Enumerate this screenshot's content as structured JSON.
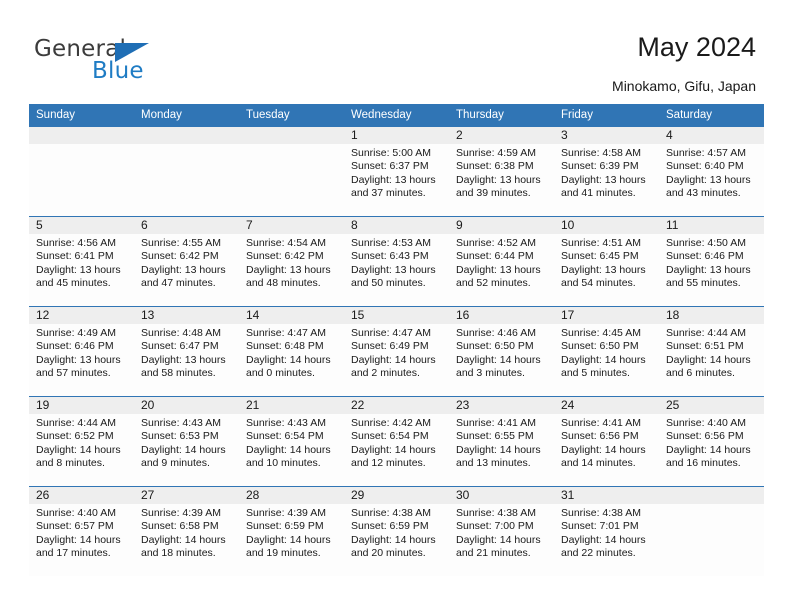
{
  "brand": {
    "name_top": "General",
    "name_bottom": "Blue",
    "accent_color": "#1f7cc4",
    "triangle_color": "#1f6eb5"
  },
  "header": {
    "title": "May 2024",
    "subtitle": "Minokamo, Gifu, Japan"
  },
  "calendar": {
    "header_bg": "#3075b5",
    "daynum_bg": "#eeeeee",
    "weekdays": [
      "Sunday",
      "Monday",
      "Tuesday",
      "Wednesday",
      "Thursday",
      "Friday",
      "Saturday"
    ],
    "weeks": [
      {
        "daynums": [
          "",
          "",
          "",
          "1",
          "2",
          "3",
          "4"
        ],
        "cells": [
          {
            "empty": true,
            "l1": "",
            "l2": "",
            "l3": "",
            "l4": ""
          },
          {
            "empty": true,
            "l1": "",
            "l2": "",
            "l3": "",
            "l4": ""
          },
          {
            "empty": true,
            "l1": "",
            "l2": "",
            "l3": "",
            "l4": ""
          },
          {
            "empty": false,
            "l1": "Sunrise: 5:00 AM",
            "l2": "Sunset: 6:37 PM",
            "l3": "Daylight: 13 hours",
            "l4": "and 37 minutes."
          },
          {
            "empty": false,
            "l1": "Sunrise: 4:59 AM",
            "l2": "Sunset: 6:38 PM",
            "l3": "Daylight: 13 hours",
            "l4": "and 39 minutes."
          },
          {
            "empty": false,
            "l1": "Sunrise: 4:58 AM",
            "l2": "Sunset: 6:39 PM",
            "l3": "Daylight: 13 hours",
            "l4": "and 41 minutes."
          },
          {
            "empty": false,
            "l1": "Sunrise: 4:57 AM",
            "l2": "Sunset: 6:40 PM",
            "l3": "Daylight: 13 hours",
            "l4": "and 43 minutes."
          }
        ]
      },
      {
        "daynums": [
          "5",
          "6",
          "7",
          "8",
          "9",
          "10",
          "11"
        ],
        "cells": [
          {
            "empty": false,
            "l1": "Sunrise: 4:56 AM",
            "l2": "Sunset: 6:41 PM",
            "l3": "Daylight: 13 hours",
            "l4": "and 45 minutes."
          },
          {
            "empty": false,
            "l1": "Sunrise: 4:55 AM",
            "l2": "Sunset: 6:42 PM",
            "l3": "Daylight: 13 hours",
            "l4": "and 47 minutes."
          },
          {
            "empty": false,
            "l1": "Sunrise: 4:54 AM",
            "l2": "Sunset: 6:42 PM",
            "l3": "Daylight: 13 hours",
            "l4": "and 48 minutes."
          },
          {
            "empty": false,
            "l1": "Sunrise: 4:53 AM",
            "l2": "Sunset: 6:43 PM",
            "l3": "Daylight: 13 hours",
            "l4": "and 50 minutes."
          },
          {
            "empty": false,
            "l1": "Sunrise: 4:52 AM",
            "l2": "Sunset: 6:44 PM",
            "l3": "Daylight: 13 hours",
            "l4": "and 52 minutes."
          },
          {
            "empty": false,
            "l1": "Sunrise: 4:51 AM",
            "l2": "Sunset: 6:45 PM",
            "l3": "Daylight: 13 hours",
            "l4": "and 54 minutes."
          },
          {
            "empty": false,
            "l1": "Sunrise: 4:50 AM",
            "l2": "Sunset: 6:46 PM",
            "l3": "Daylight: 13 hours",
            "l4": "and 55 minutes."
          }
        ]
      },
      {
        "daynums": [
          "12",
          "13",
          "14",
          "15",
          "16",
          "17",
          "18"
        ],
        "cells": [
          {
            "empty": false,
            "l1": "Sunrise: 4:49 AM",
            "l2": "Sunset: 6:46 PM",
            "l3": "Daylight: 13 hours",
            "l4": "and 57 minutes."
          },
          {
            "empty": false,
            "l1": "Sunrise: 4:48 AM",
            "l2": "Sunset: 6:47 PM",
            "l3": "Daylight: 13 hours",
            "l4": "and 58 minutes."
          },
          {
            "empty": false,
            "l1": "Sunrise: 4:47 AM",
            "l2": "Sunset: 6:48 PM",
            "l3": "Daylight: 14 hours",
            "l4": "and 0 minutes."
          },
          {
            "empty": false,
            "l1": "Sunrise: 4:47 AM",
            "l2": "Sunset: 6:49 PM",
            "l3": "Daylight: 14 hours",
            "l4": "and 2 minutes."
          },
          {
            "empty": false,
            "l1": "Sunrise: 4:46 AM",
            "l2": "Sunset: 6:50 PM",
            "l3": "Daylight: 14 hours",
            "l4": "and 3 minutes."
          },
          {
            "empty": false,
            "l1": "Sunrise: 4:45 AM",
            "l2": "Sunset: 6:50 PM",
            "l3": "Daylight: 14 hours",
            "l4": "and 5 minutes."
          },
          {
            "empty": false,
            "l1": "Sunrise: 4:44 AM",
            "l2": "Sunset: 6:51 PM",
            "l3": "Daylight: 14 hours",
            "l4": "and 6 minutes."
          }
        ]
      },
      {
        "daynums": [
          "19",
          "20",
          "21",
          "22",
          "23",
          "24",
          "25"
        ],
        "cells": [
          {
            "empty": false,
            "l1": "Sunrise: 4:44 AM",
            "l2": "Sunset: 6:52 PM",
            "l3": "Daylight: 14 hours",
            "l4": "and 8 minutes."
          },
          {
            "empty": false,
            "l1": "Sunrise: 4:43 AM",
            "l2": "Sunset: 6:53 PM",
            "l3": "Daylight: 14 hours",
            "l4": "and 9 minutes."
          },
          {
            "empty": false,
            "l1": "Sunrise: 4:43 AM",
            "l2": "Sunset: 6:54 PM",
            "l3": "Daylight: 14 hours",
            "l4": "and 10 minutes."
          },
          {
            "empty": false,
            "l1": "Sunrise: 4:42 AM",
            "l2": "Sunset: 6:54 PM",
            "l3": "Daylight: 14 hours",
            "l4": "and 12 minutes."
          },
          {
            "empty": false,
            "l1": "Sunrise: 4:41 AM",
            "l2": "Sunset: 6:55 PM",
            "l3": "Daylight: 14 hours",
            "l4": "and 13 minutes."
          },
          {
            "empty": false,
            "l1": "Sunrise: 4:41 AM",
            "l2": "Sunset: 6:56 PM",
            "l3": "Daylight: 14 hours",
            "l4": "and 14 minutes."
          },
          {
            "empty": false,
            "l1": "Sunrise: 4:40 AM",
            "l2": "Sunset: 6:56 PM",
            "l3": "Daylight: 14 hours",
            "l4": "and 16 minutes."
          }
        ]
      },
      {
        "daynums": [
          "26",
          "27",
          "28",
          "29",
          "30",
          "31",
          ""
        ],
        "cells": [
          {
            "empty": false,
            "l1": "Sunrise: 4:40 AM",
            "l2": "Sunset: 6:57 PM",
            "l3": "Daylight: 14 hours",
            "l4": "and 17 minutes."
          },
          {
            "empty": false,
            "l1": "Sunrise: 4:39 AM",
            "l2": "Sunset: 6:58 PM",
            "l3": "Daylight: 14 hours",
            "l4": "and 18 minutes."
          },
          {
            "empty": false,
            "l1": "Sunrise: 4:39 AM",
            "l2": "Sunset: 6:59 PM",
            "l3": "Daylight: 14 hours",
            "l4": "and 19 minutes."
          },
          {
            "empty": false,
            "l1": "Sunrise: 4:38 AM",
            "l2": "Sunset: 6:59 PM",
            "l3": "Daylight: 14 hours",
            "l4": "and 20 minutes."
          },
          {
            "empty": false,
            "l1": "Sunrise: 4:38 AM",
            "l2": "Sunset: 7:00 PM",
            "l3": "Daylight: 14 hours",
            "l4": "and 21 minutes."
          },
          {
            "empty": false,
            "l1": "Sunrise: 4:38 AM",
            "l2": "Sunset: 7:01 PM",
            "l3": "Daylight: 14 hours",
            "l4": "and 22 minutes."
          },
          {
            "empty": true,
            "l1": "",
            "l2": "",
            "l3": "",
            "l4": ""
          }
        ]
      }
    ]
  }
}
